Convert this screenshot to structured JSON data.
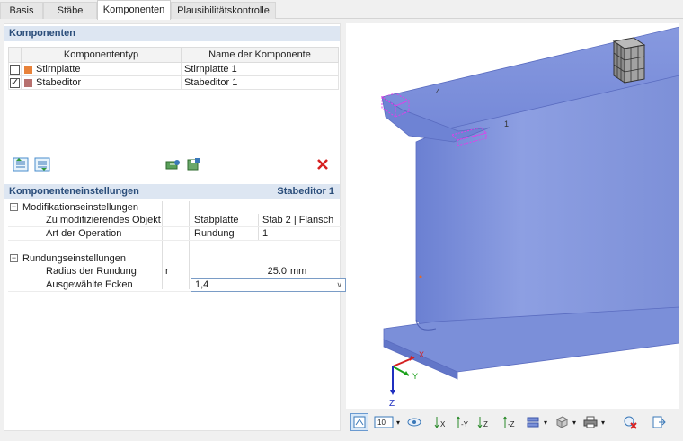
{
  "tabs": [
    {
      "label": "Basis",
      "active": false
    },
    {
      "label": "Stäbe",
      "active": false
    },
    {
      "label": "Komponenten",
      "active": true
    },
    {
      "label": "Plausibilitätskontrolle",
      "active": false
    }
  ],
  "components": {
    "title": "Komponenten",
    "columns": [
      "Komponententyp",
      "Name der Komponente"
    ],
    "rows": [
      {
        "checked": false,
        "color": "#e8823a",
        "type": "Stirnplatte",
        "name": "Stirnplatte 1"
      },
      {
        "checked": true,
        "color": "#b7706e",
        "type": "Stabeditor",
        "name": "Stabeditor 1"
      }
    ]
  },
  "settings": {
    "title": "Komponenteneinstellungen",
    "current": "Stabeditor 1",
    "groups": [
      {
        "label": "Modifikationseinstellungen",
        "rows": [
          {
            "label": "Zu modifizierendes Objekt",
            "symbol": "",
            "value": "Stabplatte",
            "value2": "Stab 2 | Flansch 1"
          },
          {
            "label": "Art der Operation",
            "symbol": "",
            "value": "Rundung",
            "value2": ""
          }
        ]
      },
      {
        "label": "Rundungseinstellungen",
        "rows": [
          {
            "label": "Radius der Rundung",
            "symbol": "r",
            "value": "25.0",
            "unit": "mm"
          },
          {
            "label": "Ausgewählte Ecken",
            "symbol": "",
            "value": "1,4"
          }
        ]
      }
    ]
  },
  "view3d": {
    "labels": [
      "4",
      "1"
    ],
    "axes": {
      "x": "X",
      "y": "Y",
      "z": "Z"
    },
    "toolbar_zoom_value": "10"
  },
  "colors": {
    "section_header_bg": "#dde6f2",
    "section_header_text": "#2a4d7a",
    "beam": "#7f93dc",
    "highlight": "#e040e8",
    "delete": "#d62020"
  }
}
